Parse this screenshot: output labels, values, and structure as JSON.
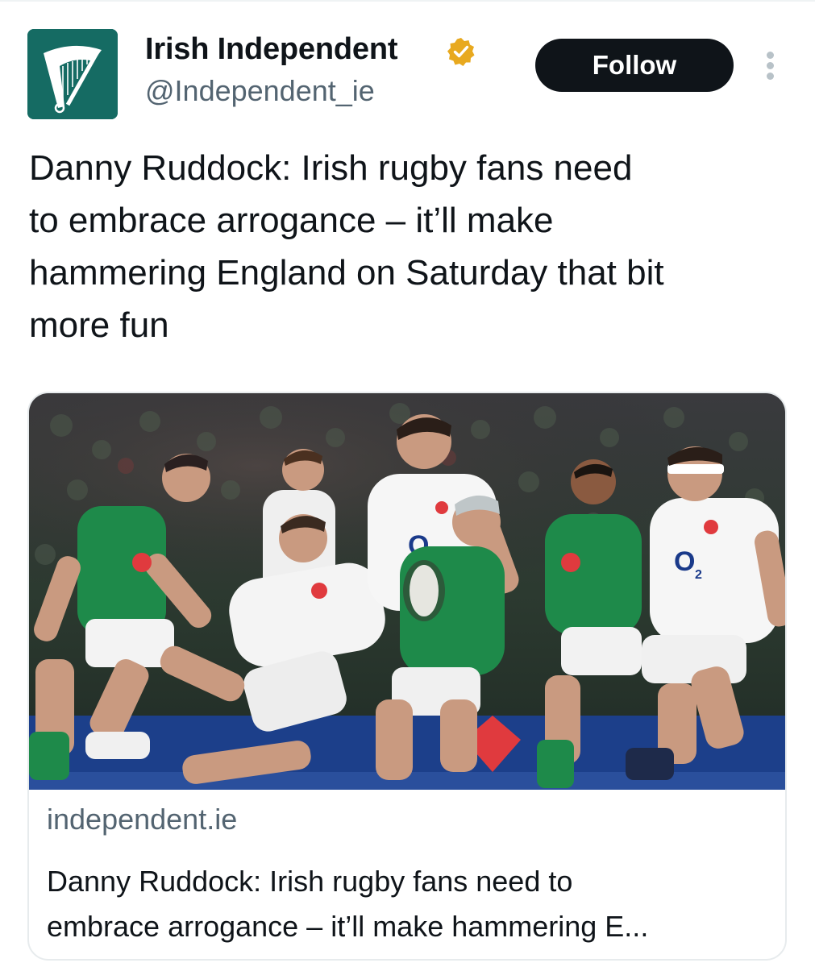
{
  "account": {
    "display_name": "Irish Independent",
    "handle": "@Independent_ie",
    "verified": true,
    "avatar_icon": "harp-logo-icon"
  },
  "actions": {
    "follow_label": "Follow",
    "more_icon": "more-vertical-icon"
  },
  "tweet": {
    "text_lines": [
      "Danny Ruddock: Irish rugby fans need",
      "to embrace arrogance – it’ll make",
      "hammering England on Saturday that bit",
      "more fun"
    ]
  },
  "link_card": {
    "image_icon": "rugby-match-photo",
    "domain": "independent.ie",
    "title_lines": [
      "Danny Ruddock: Irish rugby fans need to",
      "embrace arrogance – it’ll make hammering E..."
    ]
  },
  "colors": {
    "avatar_bg": "#156b63",
    "follow_bg": "#0f1419",
    "badge_gold": "#e8a91f",
    "secondary_text": "#536471"
  }
}
